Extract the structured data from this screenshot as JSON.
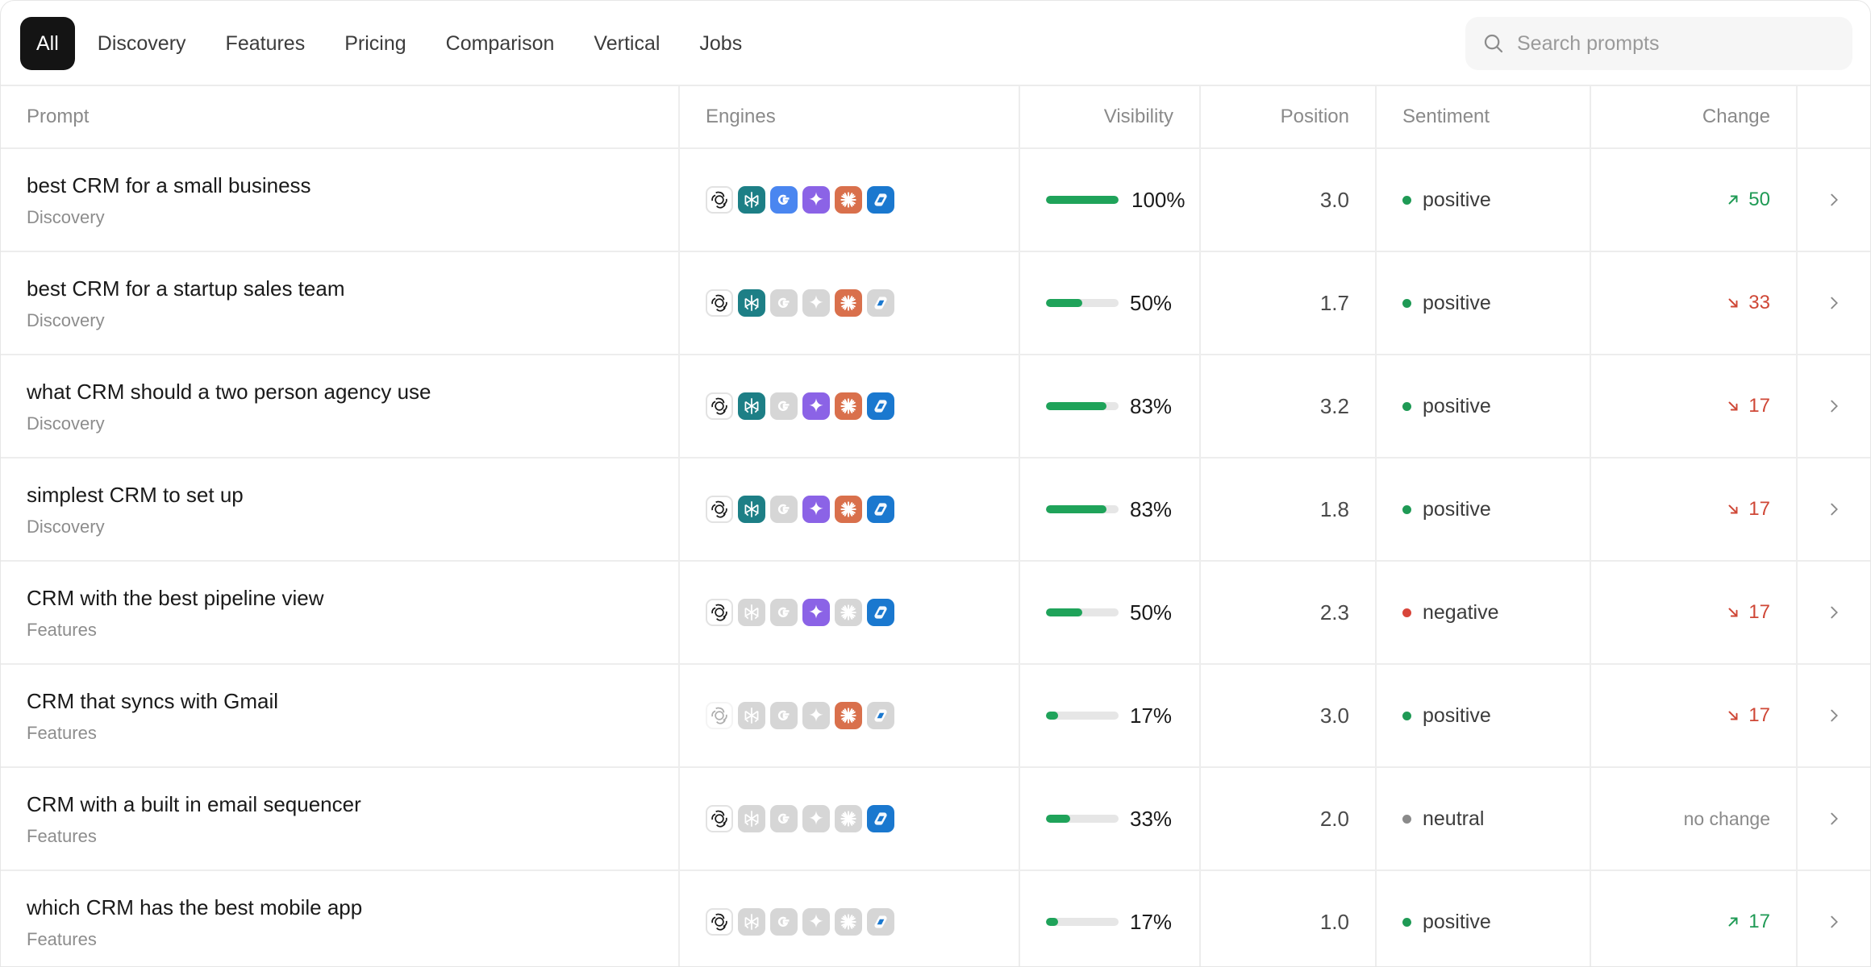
{
  "tabs": [
    {
      "label": "All",
      "active": true
    },
    {
      "label": "Discovery",
      "active": false
    },
    {
      "label": "Features",
      "active": false
    },
    {
      "label": "Pricing",
      "active": false
    },
    {
      "label": "Comparison",
      "active": false
    },
    {
      "label": "Vertical",
      "active": false
    },
    {
      "label": "Jobs",
      "active": false
    }
  ],
  "search": {
    "placeholder": "Search prompts",
    "value": ""
  },
  "columns": {
    "prompt": "Prompt",
    "engines": "Engines",
    "visibility": "Visibility",
    "position": "Position",
    "sentiment": "Sentiment",
    "change": "Change"
  },
  "engine_names": [
    "openai-icon",
    "perplexity-icon",
    "google-icon",
    "gemini-icon",
    "claude-icon",
    "copilot-icon"
  ],
  "colors": {
    "visibility_bar": "#1fa35a",
    "positive": "#1f9a55",
    "negative": "#d8453a",
    "neutral": "#8a8a8a",
    "change_up": "#1f9a55",
    "change_down": "#cf4736"
  },
  "rows": [
    {
      "prompt": "best CRM for a small business",
      "category": "Discovery",
      "engines": [
        true,
        true,
        true,
        true,
        true,
        true
      ],
      "visibility": 100,
      "visibility_label": "100%",
      "position": "3.0",
      "sentiment": "positive",
      "change_dir": "up",
      "change": "50"
    },
    {
      "prompt": "best CRM for a startup sales team",
      "category": "Discovery",
      "engines": [
        true,
        true,
        false,
        false,
        true,
        false
      ],
      "visibility": 50,
      "visibility_label": "50%",
      "position": "1.7",
      "sentiment": "positive",
      "change_dir": "down",
      "change": "33"
    },
    {
      "prompt": "what CRM should a two person agency use",
      "category": "Discovery",
      "engines": [
        true,
        true,
        false,
        true,
        true,
        true
      ],
      "visibility": 83,
      "visibility_label": "83%",
      "position": "3.2",
      "sentiment": "positive",
      "change_dir": "down",
      "change": "17"
    },
    {
      "prompt": "simplest CRM to set up",
      "category": "Discovery",
      "engines": [
        true,
        true,
        false,
        true,
        true,
        true
      ],
      "visibility": 83,
      "visibility_label": "83%",
      "position": "1.8",
      "sentiment": "positive",
      "change_dir": "down",
      "change": "17"
    },
    {
      "prompt": "CRM with the best pipeline view",
      "category": "Features",
      "engines": [
        true,
        false,
        false,
        true,
        false,
        true
      ],
      "visibility": 50,
      "visibility_label": "50%",
      "position": "2.3",
      "sentiment": "negative",
      "change_dir": "down",
      "change": "17"
    },
    {
      "prompt": "CRM that syncs with Gmail",
      "category": "Features",
      "engines": [
        false,
        false,
        false,
        false,
        true,
        false
      ],
      "visibility": 17,
      "visibility_label": "17%",
      "position": "3.0",
      "sentiment": "positive",
      "change_dir": "down",
      "change": "17"
    },
    {
      "prompt": "CRM with a built in email sequencer",
      "category": "Features",
      "engines": [
        true,
        false,
        false,
        false,
        false,
        true
      ],
      "visibility": 33,
      "visibility_label": "33%",
      "position": "2.0",
      "sentiment": "neutral",
      "change_dir": "none",
      "change": "no change"
    },
    {
      "prompt": "which CRM has the best mobile app",
      "category": "Features",
      "engines": [
        true,
        false,
        false,
        false,
        false,
        false
      ],
      "visibility": 17,
      "visibility_label": "17%",
      "position": "1.0",
      "sentiment": "positive",
      "change_dir": "up",
      "change": "17"
    }
  ]
}
